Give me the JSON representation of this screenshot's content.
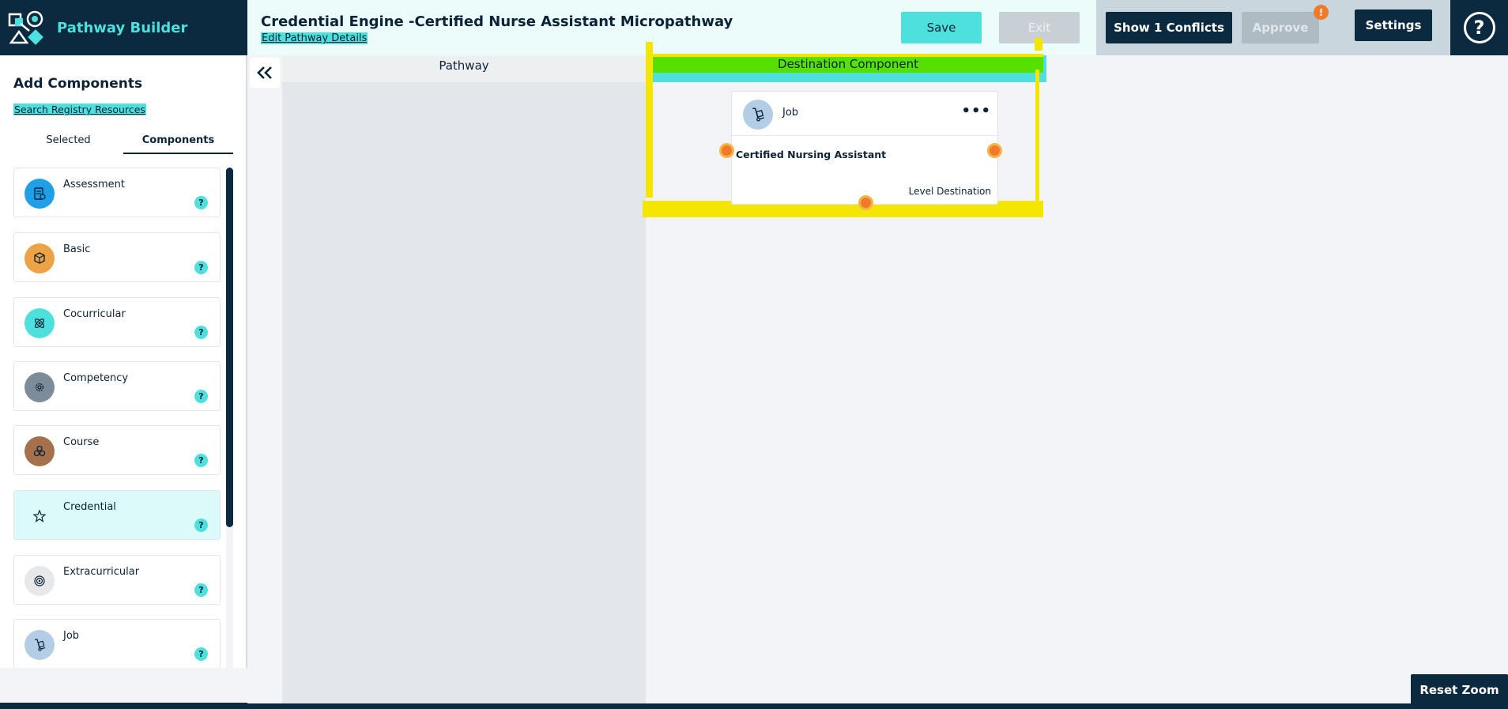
{
  "header": {
    "brand": "Pathway Builder",
    "title": "Credential Engine -Certified Nurse Assistant Micropathway",
    "edit_link": "Edit Pathway Details",
    "save_label": "Save",
    "exit_label": "Exit",
    "conflicts_label": "Show 1 Conflicts",
    "approve_label": "Approve",
    "approve_badge": "!",
    "settings_label": "Settings",
    "help_glyph": "?"
  },
  "sidebar": {
    "title": "Add Components",
    "search_link": "Search Registry Resources",
    "tabs": [
      {
        "label": "Selected",
        "active": false
      },
      {
        "label": "Components",
        "active": true
      }
    ],
    "items": [
      {
        "label": "Assessment",
        "icon": "assessment-icon",
        "color": "#1e9fe8",
        "help": "?"
      },
      {
        "label": "Basic",
        "icon": "cube-icon",
        "color": "#eea246",
        "help": "?"
      },
      {
        "label": "Cocurricular",
        "icon": "atom-icon",
        "color": "#4ee0dc",
        "help": "?"
      },
      {
        "label": "Competency",
        "icon": "gear-icon",
        "color": "#7d8c99",
        "help": "?"
      },
      {
        "label": "Course",
        "icon": "blocks-icon",
        "color": "#a5704c",
        "help": "?"
      },
      {
        "label": "Credential",
        "icon": "star-icon",
        "color": "#dcfafa",
        "help": "?"
      },
      {
        "label": "Extracurricular",
        "icon": "target-icon",
        "color": "#e6e8ea",
        "help": "?"
      },
      {
        "label": "Job",
        "icon": "hand-truck-icon",
        "color": "#b4cde6",
        "help": "?"
      }
    ]
  },
  "canvas": {
    "pathway_header": "Pathway",
    "destination_header": "Destination Component",
    "node": {
      "type": "Job",
      "name": "Certified Nursing Assistant",
      "level": "Level Destination",
      "menu": "•••"
    },
    "reset_zoom_label": "Reset Zoom"
  },
  "colors": {
    "navy": "#0b2a3f",
    "teal": "#4ee0dc",
    "orange": "#f07a28",
    "highlight_yellow": "#f4e600",
    "highlight_green": "#55e000"
  }
}
